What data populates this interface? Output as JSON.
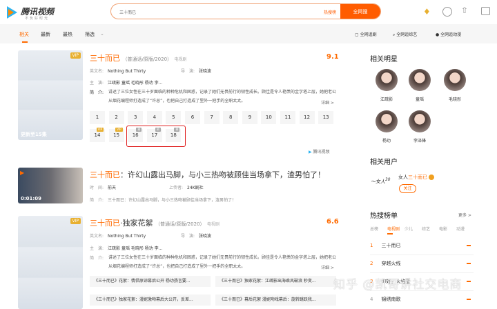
{
  "header": {
    "logo": "腾讯视频",
    "slogan": "不负好时光",
    "search_value": "三十而已",
    "hot_label": "热搜榜",
    "search_button": "全网搜"
  },
  "nav": {
    "tabs": [
      "相关",
      "最新",
      "最热",
      "筛选"
    ],
    "right": [
      "全网追剧",
      "全网追综艺",
      "全网追动漫"
    ]
  },
  "results": [
    {
      "title": "三十而已",
      "meta": "（普通话/原版/2020）",
      "category": "电视剧",
      "score": "9.1",
      "vip": "VIP",
      "update": "更新至15集",
      "en_label": "英文名:",
      "en": "Nothing But Thirty",
      "dir_label": "导　演:",
      "director": "张晓波",
      "cast_label": "主　演:",
      "cast": "江疏影  童瑶  毛晓彤  杨玏  李...",
      "desc_label": "简　介:",
      "desc": "讲述了三位女性在三十岁面临的种种危机和困惑，记录了她们无畏前行的韧性成长。顾佳是令人艳羡的金字塔上层，她把老公从烟花编程师打造成了“许总”，也把自己打造成了里外一把手的全职太太。",
      "more": "详细 >",
      "episodes": [
        "1",
        "2",
        "3",
        "4",
        "5",
        "6",
        "7",
        "8",
        "9",
        "10",
        "11",
        "12",
        "13",
        "14",
        "15",
        "16",
        "17",
        "18"
      ],
      "ep_badges": {
        "14": "VIP",
        "15": "VIP",
        "16": "预",
        "17": "预",
        "18": "预"
      },
      "source": "腾讯视频"
    },
    {
      "title_hl": "三十而已",
      "title": "：许幻山露出马脚，与小三热吻被顾佳当场拿下，渣男怕了！",
      "duration": "0:01:09",
      "time_label": "时　间:",
      "time": "前天",
      "uploader_label": "上传者:",
      "uploader": "24K剧社",
      "desc_label": "简　介:",
      "desc": "三十而已：许幻山露出马脚，与小三热吻被顾佳当场拿下，渣男怕了！"
    },
    {
      "title_hl": "三十而已",
      "title": "·独家花絮",
      "meta": "（普通话/原版/2020）",
      "category": "电视剧",
      "score": "6.6",
      "vip": "VIP",
      "en_label": "英文名:",
      "en": "Nothing But Thirty",
      "dir_label": "导　演:",
      "director": "张晓波",
      "cast_label": "主　演:",
      "cast": "江疏影  童瑶  毛晓彤  杨玏  李...",
      "desc_label": "简　介:",
      "desc": "讲述了三位女性在三十岁面临的种种危机和困惑，记录了她们无畏前行的韧性成长。顾佳是令人艳羡的金字塔上层，她把老公从烟花编程师打造成了“许总”，也把自己打造成了里外一把手的全职太太。",
      "more": "详细 >",
      "clips": [
        "《三十而已》花絮：情侣原谅幕后公开 杨玏扬言要...",
        "《三十而已》独家花絮：江疏影出海乘风破浪 秒变...",
        "《三十而已》独家花絮：漫妮激吻幕后大公开，反差...",
        "《三十而已》幕后花絮 漫妮吻戏幕后：旋转跳跃我..."
      ]
    }
  ],
  "sidebar": {
    "stars_title": "相关明星",
    "stars": [
      "江疏影",
      "童瑶",
      "毛晓彤",
      "杨玏",
      "李泽锋"
    ],
    "users_title": "相关用户",
    "user_prefix": "女人",
    "user_hl": "三十而已",
    "user_logo": "女人30+",
    "follow": "关注",
    "hot_title": "热搜榜单",
    "more": "更多 >",
    "hot_tabs": [
      "总榜",
      "电视剧",
      "少儿",
      "综艺",
      "电影",
      "动漫"
    ],
    "hot_list": [
      "三十而已",
      "穿越火线",
      "你好，火焰蓝",
      "锦绣南歌"
    ]
  },
  "watermark": "知乎 @凯哥讲社交电商",
  "colors": {
    "accent": "#ff6a00"
  }
}
